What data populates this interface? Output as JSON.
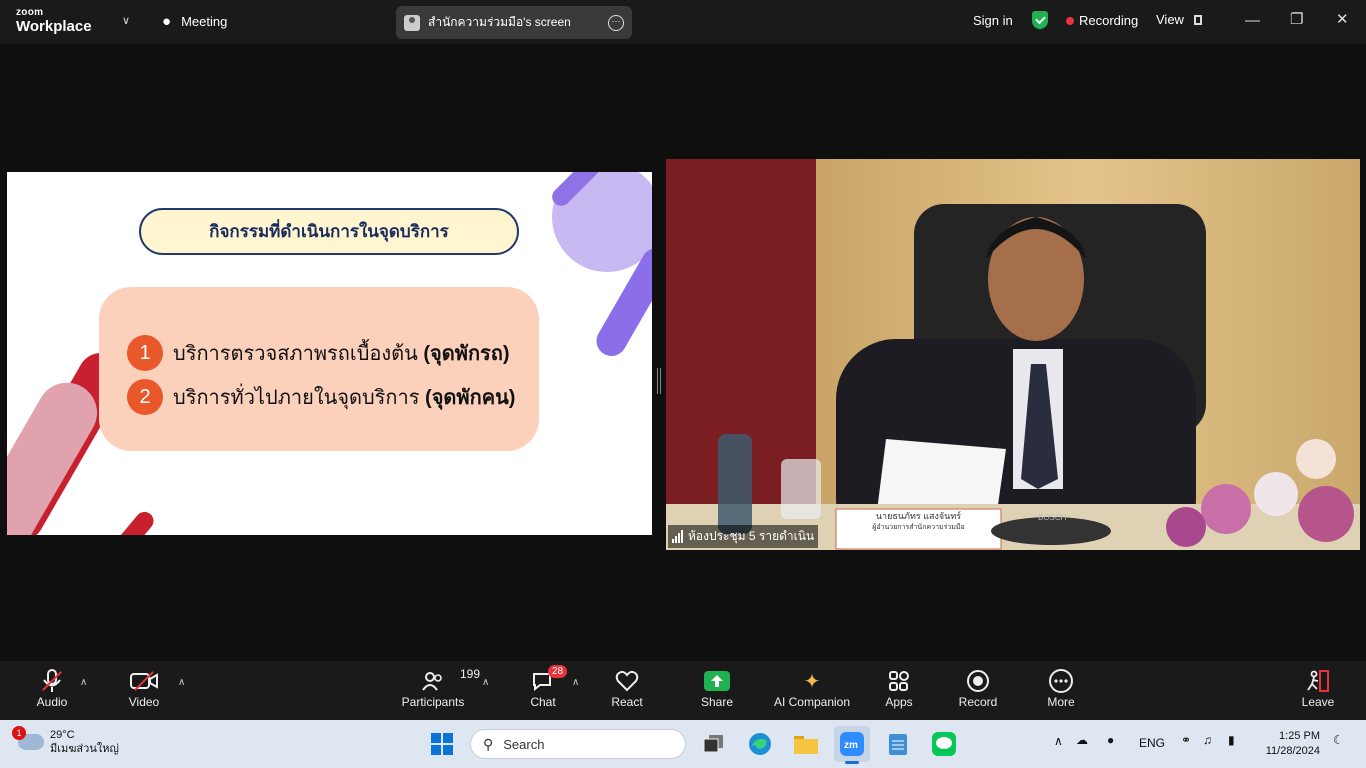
{
  "topbar": {
    "logo_line1": "zoom",
    "logo_line2": "Workplace",
    "meeting_label": "Meeting",
    "screen_share_label": "สำนักความร่วมมือ's screen",
    "sign_in": "Sign in",
    "recording": "Recording",
    "view": "View"
  },
  "slide": {
    "title": "กิจกรรมที่ดำเนินการในจุดบริการ",
    "items": [
      {
        "num": "1",
        "text": "บริการตรวจสภาพรถเบื้องต้น ",
        "bold": "(จุดพักรถ)"
      },
      {
        "num": "2",
        "text": "บริการทั่วไปภายในจุดบริการ ",
        "bold": "(จุดพักคน)"
      }
    ]
  },
  "video": {
    "participant_label": "ห้องประชุม 5 รายดำเนิน",
    "nameplate_name": "นายธนภัทร แสงจันทร์",
    "nameplate_title": "ผู้อำนวยการสำนักความร่วมมือ",
    "mic_brand": "BOSCH"
  },
  "toolbar": {
    "audio": "Audio",
    "video": "Video",
    "participants": "Participants",
    "participants_count": "199",
    "chat": "Chat",
    "chat_badge": "28",
    "react": "React",
    "share": "Share",
    "ai_companion": "AI Companion",
    "apps": "Apps",
    "record": "Record",
    "more": "More",
    "leave": "Leave"
  },
  "taskbar": {
    "weather_badge": "1",
    "temperature": "29°C",
    "weather_desc": "มีเมฆส่วนใหญ่",
    "search_placeholder": "Search",
    "language": "ENG",
    "time": "1:25 PM",
    "date": "11/28/2024"
  },
  "colors": {
    "accent_green": "#20b150",
    "record_red": "#e8323c",
    "slide_box": "#fcd1bc",
    "bullet_orange": "#e8582a"
  }
}
